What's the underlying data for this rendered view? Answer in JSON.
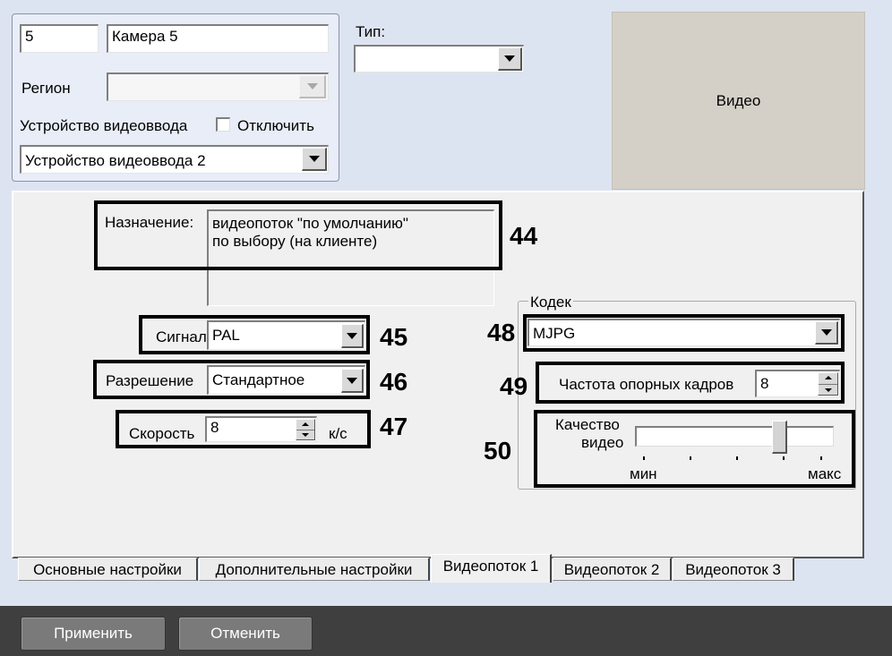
{
  "camera": {
    "number": "5",
    "name": "Камера 5"
  },
  "region": {
    "label": "Регион",
    "value": ""
  },
  "video_device": {
    "label": "Устройство видеоввода",
    "disable_label": "Отключить",
    "disable_checked": false,
    "selected": "Устройство видеоввода 2"
  },
  "type": {
    "label": "Тип:",
    "value": ""
  },
  "video_preview": {
    "label": "Видео"
  },
  "stream": {
    "purpose_label": "Назначение:",
    "purpose_lines": [
      "видеопоток \"по умолчанию\"",
      "по выбору (на клиенте)"
    ],
    "signal_label": "Сигнал",
    "signal_value": "PAL",
    "resolution_label": "Разрешение",
    "resolution_value": "Стандартное",
    "speed_label": "Скорость",
    "speed_value": "8",
    "speed_unit": "к/с"
  },
  "codec": {
    "group_label": "Кодек",
    "value": "MJPG",
    "keyframe_label": "Частота опорных кадров",
    "keyframe_value": "8",
    "quality_label_line1": "Качество",
    "quality_label_line2": "видео",
    "quality_min": "мин",
    "quality_max": "макс",
    "quality_level": 0.75
  },
  "annotations": [
    "44",
    "45",
    "46",
    "47",
    "48",
    "49",
    "50"
  ],
  "tabs": [
    "Основные настройки",
    "Дополнительные настройки",
    "Видеопоток 1",
    "Видеопоток 2",
    "Видеопоток 3"
  ],
  "active_tab": "Видеопоток 1",
  "buttons": {
    "apply": "Применить",
    "cancel": "Отменить"
  },
  "colors": {
    "background": "#dde4f1",
    "panel": "#f0f0f0",
    "preview": "#d4d0c8",
    "button": "#7a7a7a"
  }
}
